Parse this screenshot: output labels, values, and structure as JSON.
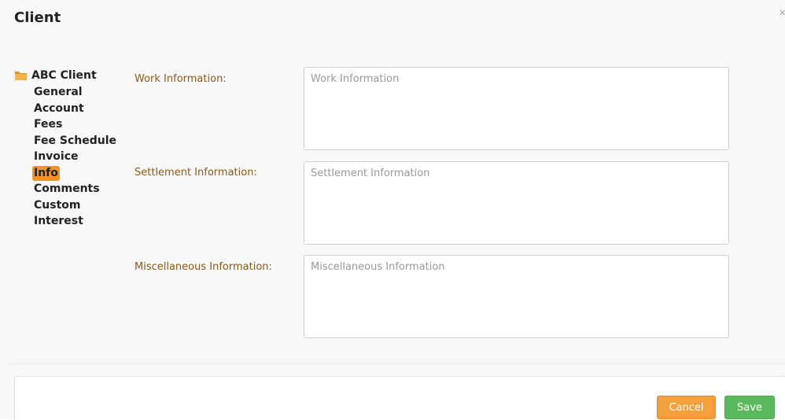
{
  "dialog": {
    "title": "Client",
    "close_icon": "close-icon"
  },
  "nav": {
    "root_label": "ABC Client",
    "root_icon": "folder-icon",
    "items": [
      {
        "label": "General",
        "active": false
      },
      {
        "label": "Account",
        "active": false
      },
      {
        "label": "Fees",
        "active": false
      },
      {
        "label": "Fee Schedule",
        "active": false
      },
      {
        "label": "Invoice",
        "active": false
      },
      {
        "label": "Info",
        "active": true
      },
      {
        "label": "Comments",
        "active": false
      },
      {
        "label": "Custom",
        "active": false
      },
      {
        "label": "Interest",
        "active": false
      }
    ]
  },
  "form": {
    "work": {
      "label": "Work Information:",
      "placeholder": "Work Information",
      "value": ""
    },
    "settlement": {
      "label": "Settlement Information:",
      "placeholder": "Settlement Information",
      "value": ""
    },
    "misc": {
      "label": "Miscellaneous Information:",
      "placeholder": "Miscellaneous Information",
      "value": ""
    }
  },
  "footer": {
    "cancel_label": "Cancel",
    "save_label": "Save"
  },
  "colors": {
    "accent_orange": "#f0932b",
    "label_brown": "#8a5a1c",
    "save_green": "#5cb85c"
  }
}
